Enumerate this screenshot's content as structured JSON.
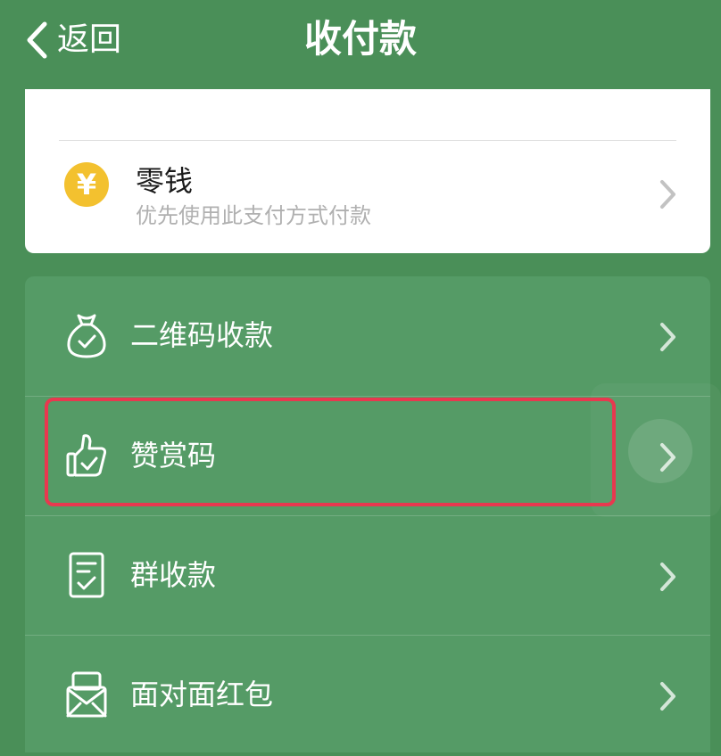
{
  "nav": {
    "back_label": "返回",
    "title": "收付款"
  },
  "balance": {
    "icon_glyph": "¥",
    "title": "零钱",
    "subtitle": "优先使用此支付方式付款"
  },
  "items": [
    {
      "label": "二维码收款",
      "icon": "money-bag-icon"
    },
    {
      "label": "赞赏码",
      "icon": "thumbs-up-icon"
    },
    {
      "label": "群收款",
      "icon": "group-receipt-icon"
    },
    {
      "label": "面对面红包",
      "icon": "red-packet-icon"
    }
  ],
  "colors": {
    "nav_background": "#4a8f58",
    "list_background": "#559b66",
    "card_background": "#ffffff",
    "yen_badge": "#f3c12f",
    "highlight_border": "#e8384f"
  }
}
